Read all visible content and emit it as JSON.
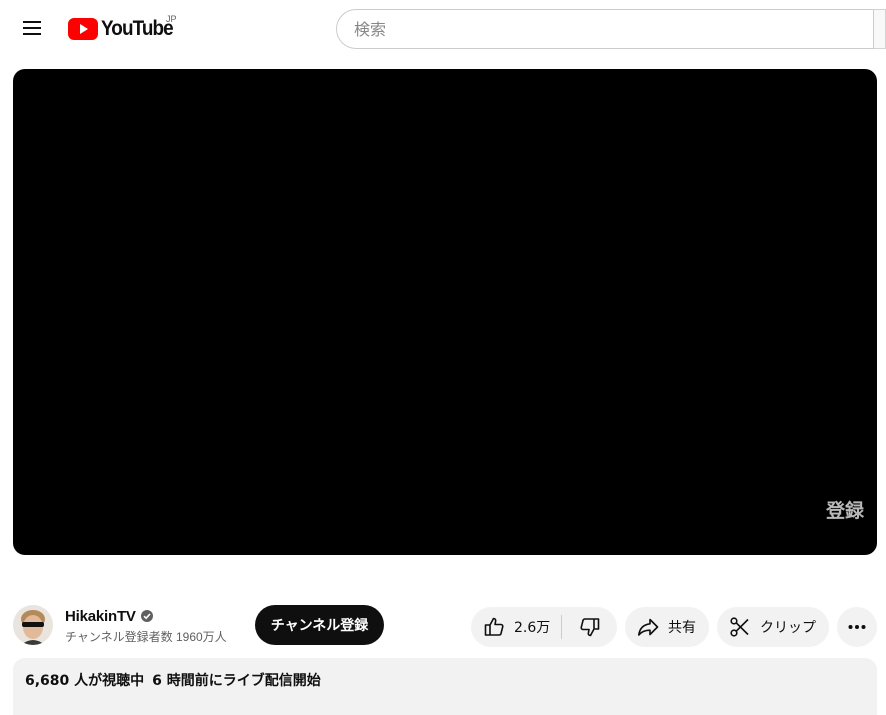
{
  "header": {
    "logo_text": "YouTube",
    "region": "JP",
    "search_placeholder": "検索"
  },
  "player": {
    "watermark": "登録"
  },
  "channel": {
    "name": "HikakinTV",
    "subscribers": "チャンネル登録者数 1960万人",
    "subscribe_label": "チャンネル登録"
  },
  "actions": {
    "likes": "2.6万",
    "share_label": "共有",
    "clip_label": "クリップ"
  },
  "description": {
    "viewers": "6,680 人が視聴中",
    "started": "6 時間前にライブ配信開始"
  },
  "colors": {
    "brand_red": "#ff0000",
    "subscribe_bg": "#0f0f0f",
    "pill_bg": "#f2f2f2"
  }
}
